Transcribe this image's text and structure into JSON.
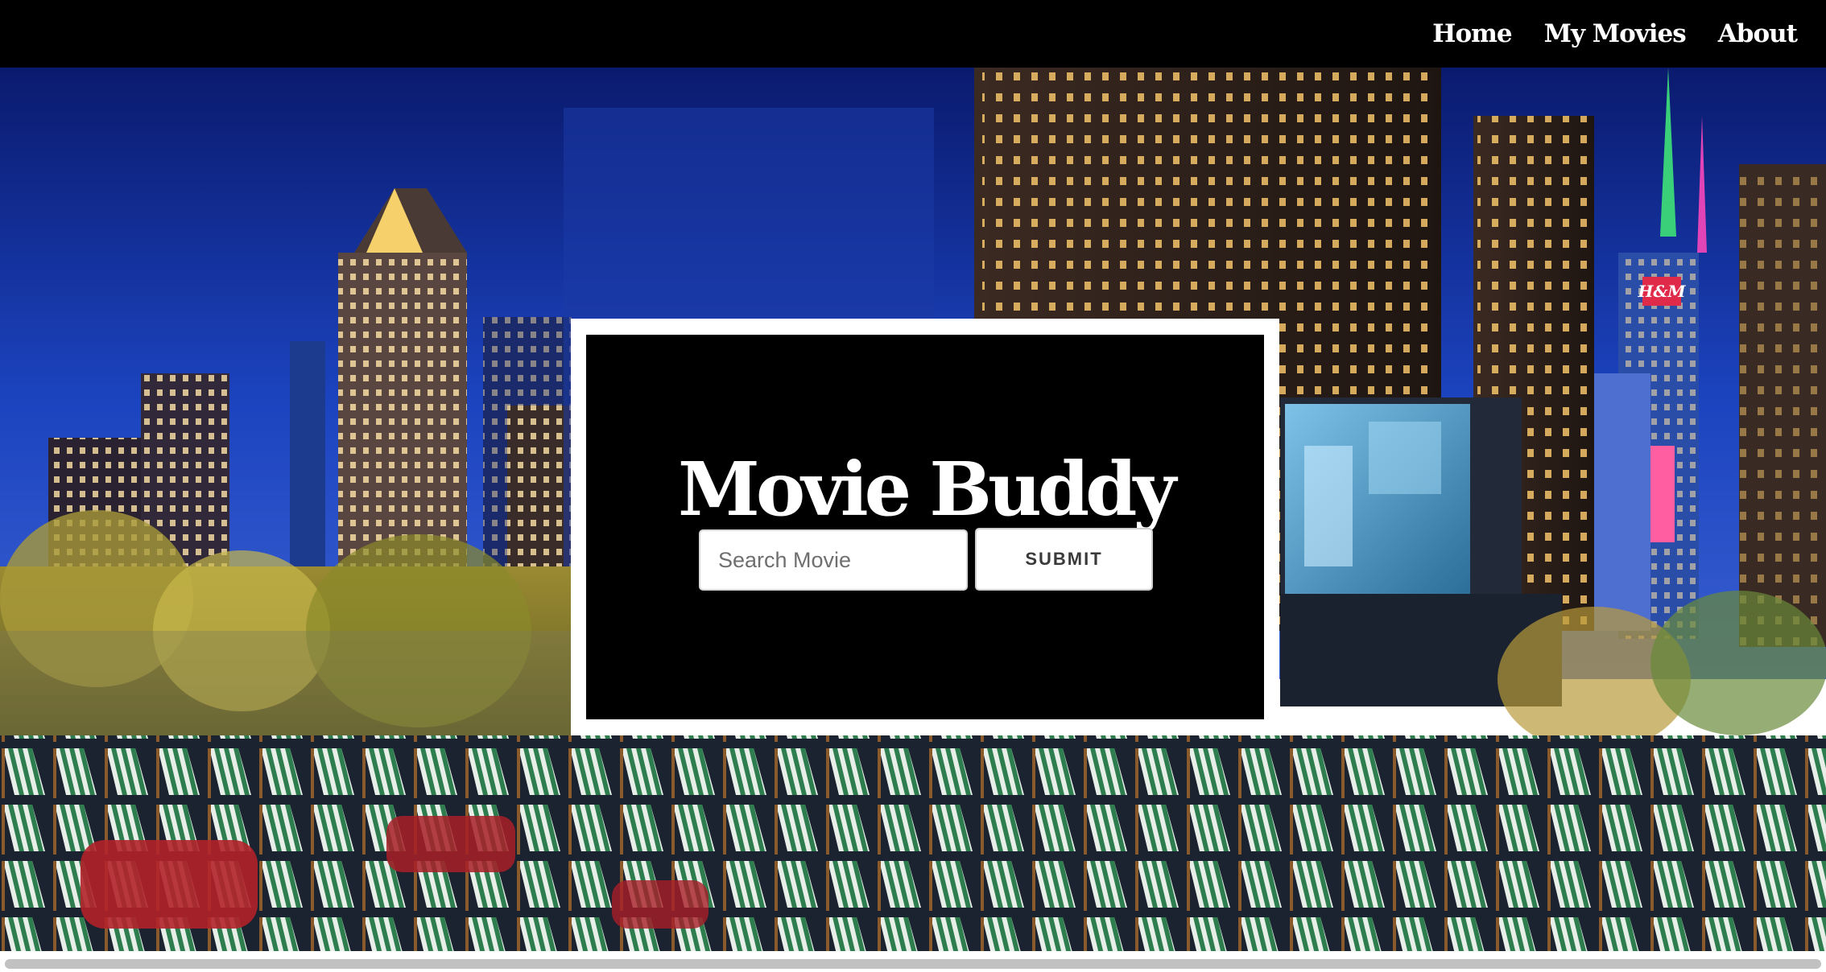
{
  "nav": {
    "items": [
      {
        "label": "Home"
      },
      {
        "label": "My Movies"
      },
      {
        "label": "About"
      }
    ]
  },
  "hero": {
    "scene_icon": "rooftop-outdoor-cinema-night-skyline",
    "sign_text": "H&M"
  },
  "card": {
    "title": "Movie Buddy",
    "search_placeholder": "Search Movie",
    "search_value": "",
    "submit_label": "SUBMIT"
  },
  "colors": {
    "nav_bg": "#000000",
    "card_bg": "#000000",
    "card_border": "#ffffff",
    "sky_top": "#0b1e7a",
    "sky_bottom": "#1d46c4",
    "chair_green": "#2e7d4f"
  }
}
